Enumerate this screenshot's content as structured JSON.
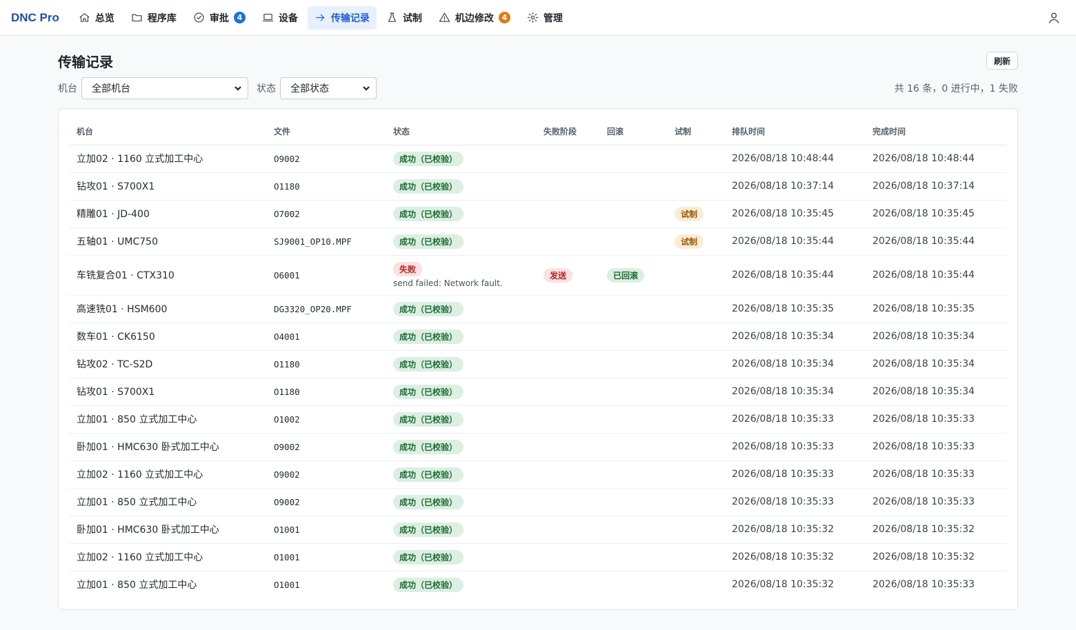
{
  "brand": "DNC Pro",
  "colors": {
    "accent": "#1f5fd1",
    "badge_blue": "#1f6fe0",
    "badge_orange": "#e07a12",
    "success": "#1a6b34",
    "danger": "#b42323",
    "warning": "#9a5a05"
  },
  "nav": [
    {
      "label": "总览",
      "icon": "home-icon"
    },
    {
      "label": "程序库",
      "icon": "folder-icon"
    },
    {
      "label": "审批",
      "icon": "check-circle-icon",
      "badge": "4",
      "badge_color": "#1f6fe0"
    },
    {
      "label": "设备",
      "icon": "monitor-icon"
    },
    {
      "label": "传输记录",
      "icon": "arrow-right-icon",
      "active": true
    },
    {
      "label": "试制",
      "icon": "flask-icon"
    },
    {
      "label": "机边修改",
      "icon": "warning-icon",
      "badge": "4",
      "badge_color": "#e07a12"
    },
    {
      "label": "管理",
      "icon": "gear-icon"
    }
  ],
  "page": {
    "title": "传输记录",
    "refresh_label": "刷新"
  },
  "filters": {
    "machine_label": "机台",
    "machine_value": "全部机台",
    "status_label": "状态",
    "status_value": "全部状态",
    "summary": "共 16 条，0 进行中，1 失败"
  },
  "table": {
    "columns": [
      "机台",
      "文件",
      "状态",
      "失败阶段",
      "回滚",
      "试制",
      "排队时间",
      "完成时间"
    ],
    "rows": [
      {
        "machine": "立加02 · 1160 立式加工中心",
        "file": "O9002",
        "status": "成功（已校验）",
        "status_type": "ok",
        "fail_stage": "",
        "rollback": "",
        "trial": "",
        "queued": "2026/08/18 10:48:44",
        "done": "2026/08/18 10:48:44"
      },
      {
        "machine": "钻攻01 · S700X1",
        "file": "O1180",
        "status": "成功（已校验）",
        "status_type": "ok",
        "fail_stage": "",
        "rollback": "",
        "trial": "",
        "queued": "2026/08/18 10:37:14",
        "done": "2026/08/18 10:37:14"
      },
      {
        "machine": "精雕01 · JD-400",
        "file": "O7002",
        "status": "成功（已校验）",
        "status_type": "ok",
        "fail_stage": "",
        "rollback": "",
        "trial": "试制",
        "queued": "2026/08/18 10:35:45",
        "done": "2026/08/18 10:35:45"
      },
      {
        "machine": "五轴01 · UMC750",
        "file": "SJ9001_OP10.MPF",
        "status": "成功（已校验）",
        "status_type": "ok",
        "fail_stage": "",
        "rollback": "",
        "trial": "试制",
        "queued": "2026/08/18 10:35:44",
        "done": "2026/08/18 10:35:44"
      },
      {
        "machine": "车铣复合01 · CTX310",
        "file": "O6001",
        "status": "失败",
        "status_type": "fail",
        "error": "send failed: Network fault.",
        "fail_stage": "发送",
        "rollback": "已回滚",
        "trial": "",
        "queued": "2026/08/18 10:35:44",
        "done": "2026/08/18 10:35:44"
      },
      {
        "machine": "高速铣01 · HSM600",
        "file": "DG3320_OP20.MPF",
        "status": "成功（已校验）",
        "status_type": "ok",
        "fail_stage": "",
        "rollback": "",
        "trial": "",
        "queued": "2026/08/18 10:35:35",
        "done": "2026/08/18 10:35:35"
      },
      {
        "machine": "数车01 · CK6150",
        "file": "O4001",
        "status": "成功（已校验）",
        "status_type": "ok",
        "fail_stage": "",
        "rollback": "",
        "trial": "",
        "queued": "2026/08/18 10:35:34",
        "done": "2026/08/18 10:35:34"
      },
      {
        "machine": "钻攻02 · TC-S2D",
        "file": "O1180",
        "status": "成功（已校验）",
        "status_type": "ok",
        "fail_stage": "",
        "rollback": "",
        "trial": "",
        "queued": "2026/08/18 10:35:34",
        "done": "2026/08/18 10:35:34"
      },
      {
        "machine": "钻攻01 · S700X1",
        "file": "O1180",
        "status": "成功（已校验）",
        "status_type": "ok",
        "fail_stage": "",
        "rollback": "",
        "trial": "",
        "queued": "2026/08/18 10:35:34",
        "done": "2026/08/18 10:35:34"
      },
      {
        "machine": "立加01 · 850 立式加工中心",
        "file": "O1002",
        "status": "成功（已校验）",
        "status_type": "ok",
        "fail_stage": "",
        "rollback": "",
        "trial": "",
        "queued": "2026/08/18 10:35:33",
        "done": "2026/08/18 10:35:33"
      },
      {
        "machine": "卧加01 · HMC630 卧式加工中心",
        "file": "O9002",
        "status": "成功（已校验）",
        "status_type": "ok",
        "fail_stage": "",
        "rollback": "",
        "trial": "",
        "queued": "2026/08/18 10:35:33",
        "done": "2026/08/18 10:35:33"
      },
      {
        "machine": "立加02 · 1160 立式加工中心",
        "file": "O9002",
        "status": "成功（已校验）",
        "status_type": "ok",
        "fail_stage": "",
        "rollback": "",
        "trial": "",
        "queued": "2026/08/18 10:35:33",
        "done": "2026/08/18 10:35:33"
      },
      {
        "machine": "立加01 · 850 立式加工中心",
        "file": "O9002",
        "status": "成功（已校验）",
        "status_type": "ok",
        "fail_stage": "",
        "rollback": "",
        "trial": "",
        "queued": "2026/08/18 10:35:33",
        "done": "2026/08/18 10:35:33"
      },
      {
        "machine": "卧加01 · HMC630 卧式加工中心",
        "file": "O1001",
        "status": "成功（已校验）",
        "status_type": "ok",
        "fail_stage": "",
        "rollback": "",
        "trial": "",
        "queued": "2026/08/18 10:35:32",
        "done": "2026/08/18 10:35:32"
      },
      {
        "machine": "立加02 · 1160 立式加工中心",
        "file": "O1001",
        "status": "成功（已校验）",
        "status_type": "ok",
        "fail_stage": "",
        "rollback": "",
        "trial": "",
        "queued": "2026/08/18 10:35:32",
        "done": "2026/08/18 10:35:32"
      },
      {
        "machine": "立加01 · 850 立式加工中心",
        "file": "O1001",
        "status": "成功（已校验）",
        "status_type": "ok",
        "fail_stage": "",
        "rollback": "",
        "trial": "",
        "queued": "2026/08/18 10:35:32",
        "done": "2026/08/18 10:35:33"
      }
    ]
  }
}
